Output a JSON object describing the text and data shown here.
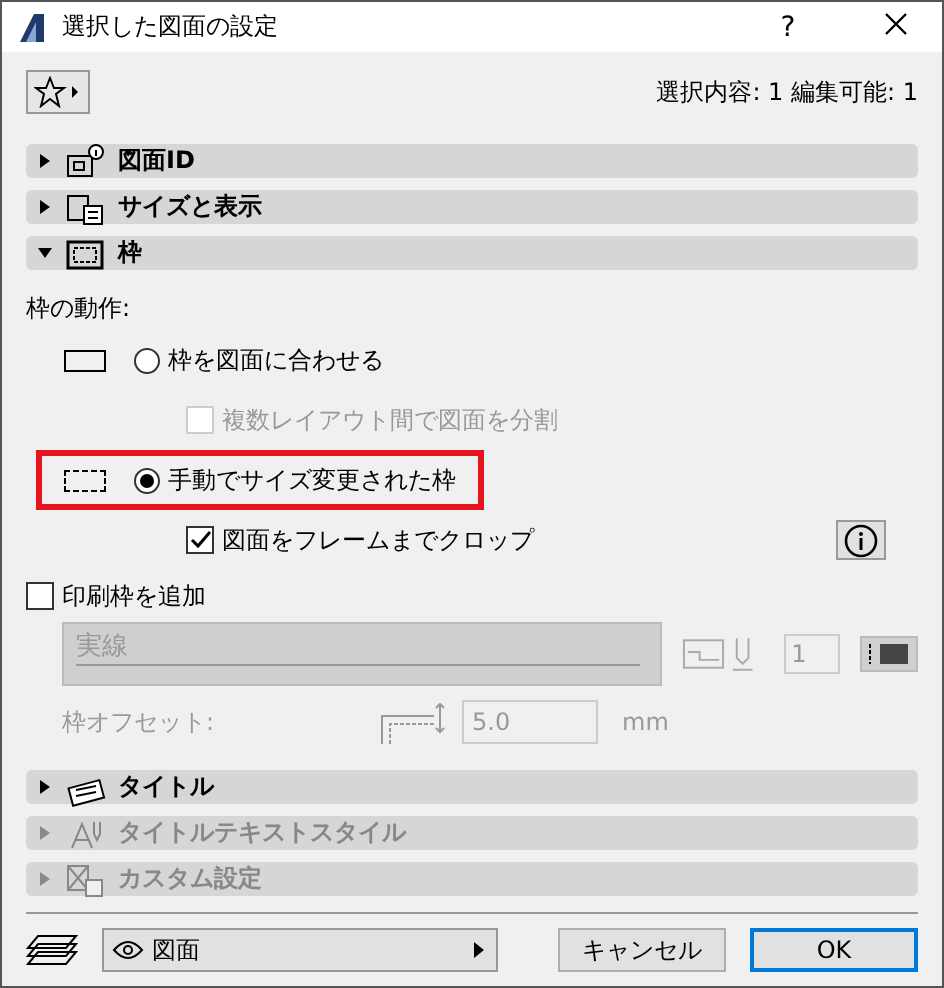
{
  "window": {
    "title": "選択した図面の設定",
    "help": "?"
  },
  "selection_info": "選択内容: 1 編集可能: 1",
  "sections": [
    {
      "title": "図面ID",
      "kind": "drawing-id",
      "expanded": false,
      "disabled": false
    },
    {
      "title": "サイズと表示",
      "kind": "size",
      "expanded": false,
      "disabled": false
    },
    {
      "title": "枠",
      "kind": "frame",
      "expanded": true,
      "disabled": false
    },
    {
      "title": "タイトル",
      "kind": "title",
      "expanded": false,
      "disabled": false
    },
    {
      "title": "タイトルテキストスタイル",
      "kind": "text-style",
      "expanded": false,
      "disabled": true
    },
    {
      "title": "カスタム設定",
      "kind": "custom",
      "expanded": false,
      "disabled": true
    }
  ],
  "frame": {
    "behavior_label": "枠の動作:",
    "options": [
      {
        "kind": "fit",
        "label": "枠を図面に合わせる",
        "selected": false,
        "highlighted": false
      },
      {
        "kind": "checkbox",
        "label": "複数レイアウト間で図面を分割",
        "checked": false,
        "disabled": true
      },
      {
        "kind": "manual",
        "label": "手動でサイズ変更された枠",
        "selected": true,
        "highlighted": true
      },
      {
        "kind": "checkbox",
        "label": "図面をフレームまでクロップ",
        "checked": true,
        "disabled": false,
        "info": true
      }
    ],
    "print_frame": {
      "label": "印刷枠を追加",
      "checked": false
    },
    "line_type": {
      "value": "実線",
      "disabled": true
    },
    "pen": {
      "value": "1"
    },
    "offset": {
      "label": "枠オフセット:",
      "value": "5.0",
      "unit": "mm"
    }
  },
  "footer": {
    "view": "図面",
    "cancel": "キャンセル",
    "ok": "OK"
  }
}
